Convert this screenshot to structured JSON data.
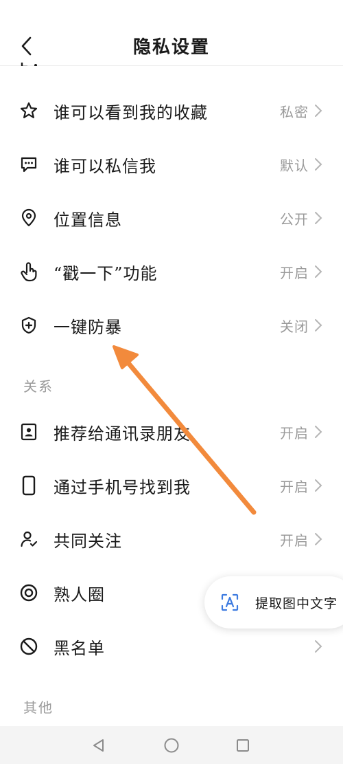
{
  "header": {
    "title": "隐私设置"
  },
  "settings": [
    {
      "label": "谁可以看到我的收藏",
      "value": "私密",
      "icon": "star-icon"
    },
    {
      "label": "谁可以私信我",
      "value": "默认",
      "icon": "message-icon"
    },
    {
      "label": "位置信息",
      "value": "公开",
      "icon": "location-icon"
    },
    {
      "label": "“戳一下”功能",
      "value": "开启",
      "icon": "poke-icon"
    },
    {
      "label": "一键防暴",
      "value": "关闭",
      "icon": "shield-plus-icon"
    }
  ],
  "sections": {
    "relations": "关系",
    "other": "其他"
  },
  "relations": [
    {
      "label": "推荐给通讯录朋友",
      "value": "开启",
      "icon": "contact-card-icon"
    },
    {
      "label": "通过手机号找到我",
      "value": "开启",
      "icon": "phone-icon"
    },
    {
      "label": "共同关注",
      "value": "开启",
      "icon": "user-check-icon"
    },
    {
      "label": "熟人圈",
      "value": "",
      "icon": "circle-dot-icon"
    },
    {
      "label": "黑名单",
      "value": "",
      "icon": "block-icon"
    }
  ],
  "ocr_button": {
    "label": "提取图中文字",
    "icon": "text-extract-icon"
  },
  "colors": {
    "accent": "#f28a3c",
    "ocr_blue": "#3d7be0",
    "muted": "#9a9a9a"
  }
}
